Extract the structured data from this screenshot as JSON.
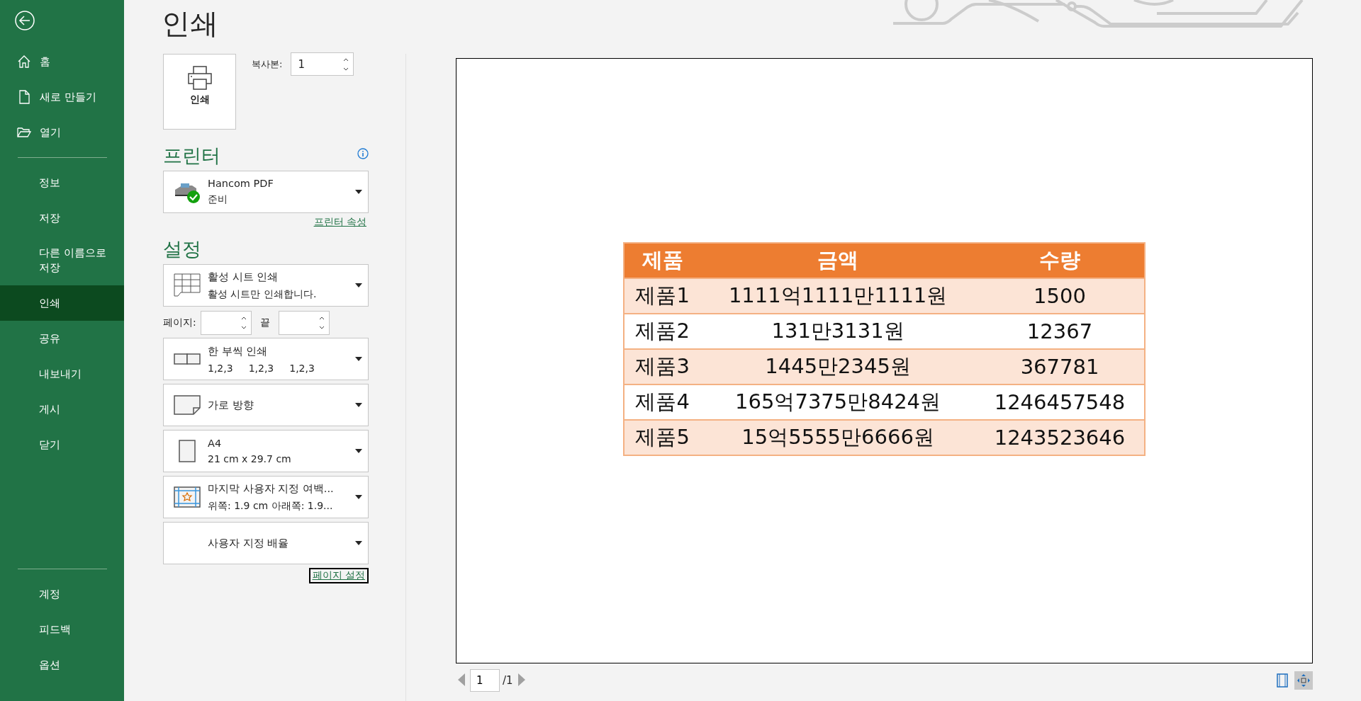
{
  "sidebar": {
    "top": [
      {
        "label": "홈",
        "selected": false
      },
      {
        "label": "새로 만들기",
        "selected": false
      },
      {
        "label": "열기",
        "selected": false
      }
    ],
    "middle": [
      {
        "label": "정보",
        "selected": false
      },
      {
        "label": "저장",
        "selected": false
      },
      {
        "label": "다른 이름으로 저장",
        "selected": false
      },
      {
        "label": "인쇄",
        "selected": true
      },
      {
        "label": "공유",
        "selected": false
      },
      {
        "label": "내보내기",
        "selected": false
      },
      {
        "label": "게시",
        "selected": false
      },
      {
        "label": "닫기",
        "selected": false
      }
    ],
    "bottom": [
      {
        "label": "계정",
        "selected": false
      },
      {
        "label": "피드백",
        "selected": false
      },
      {
        "label": "옵션",
        "selected": false
      }
    ]
  },
  "title": "인쇄",
  "print_button": "인쇄",
  "copies": {
    "label": "복사본:",
    "value": "1"
  },
  "printer": {
    "heading": "프린터",
    "name": "Hancom PDF",
    "status": "준비",
    "properties_link": "프린터 속성"
  },
  "settings": {
    "heading": "설정",
    "dropdowns": [
      {
        "title": "활성 시트 인쇄",
        "subtitle": "활성 시트만 인쇄합니다."
      }
    ],
    "pages": {
      "label": "페이지:",
      "to_label": "끝"
    },
    "more_dropdowns": [
      {
        "title": "한 부씩 인쇄",
        "subtitle_parts": [
          "1,2,3",
          "1,2,3",
          "1,2,3"
        ]
      },
      {
        "title": "가로 방향"
      },
      {
        "title": "A4",
        "subtitle": "21 cm x 29.7 cm"
      },
      {
        "title": "마지막 사용자 지정 여백...",
        "subtitle": "위쪽: 1.9 cm 아래쪽: 1.9..."
      },
      {
        "title": "사용자 지정 배율"
      }
    ],
    "page_setup_link": "페이지 설정"
  },
  "preview": {
    "table": {
      "columns": [
        "제품",
        "금액",
        "수량"
      ],
      "rows": [
        [
          "제품1",
          "1111억1111만1111원",
          "1500"
        ],
        [
          "제품2",
          "131만3131원",
          "12367"
        ],
        [
          "제품3",
          "1445만2345원",
          "367781"
        ],
        [
          "제품4",
          "165억7375만8424원",
          "1246457548"
        ],
        [
          "제품5",
          "15억5555만6666원",
          "1243523646"
        ]
      ]
    },
    "page_number": "1",
    "page_total": "/1",
    "view_buttons": [
      {
        "selected": false
      },
      {
        "selected": true
      }
    ]
  }
}
